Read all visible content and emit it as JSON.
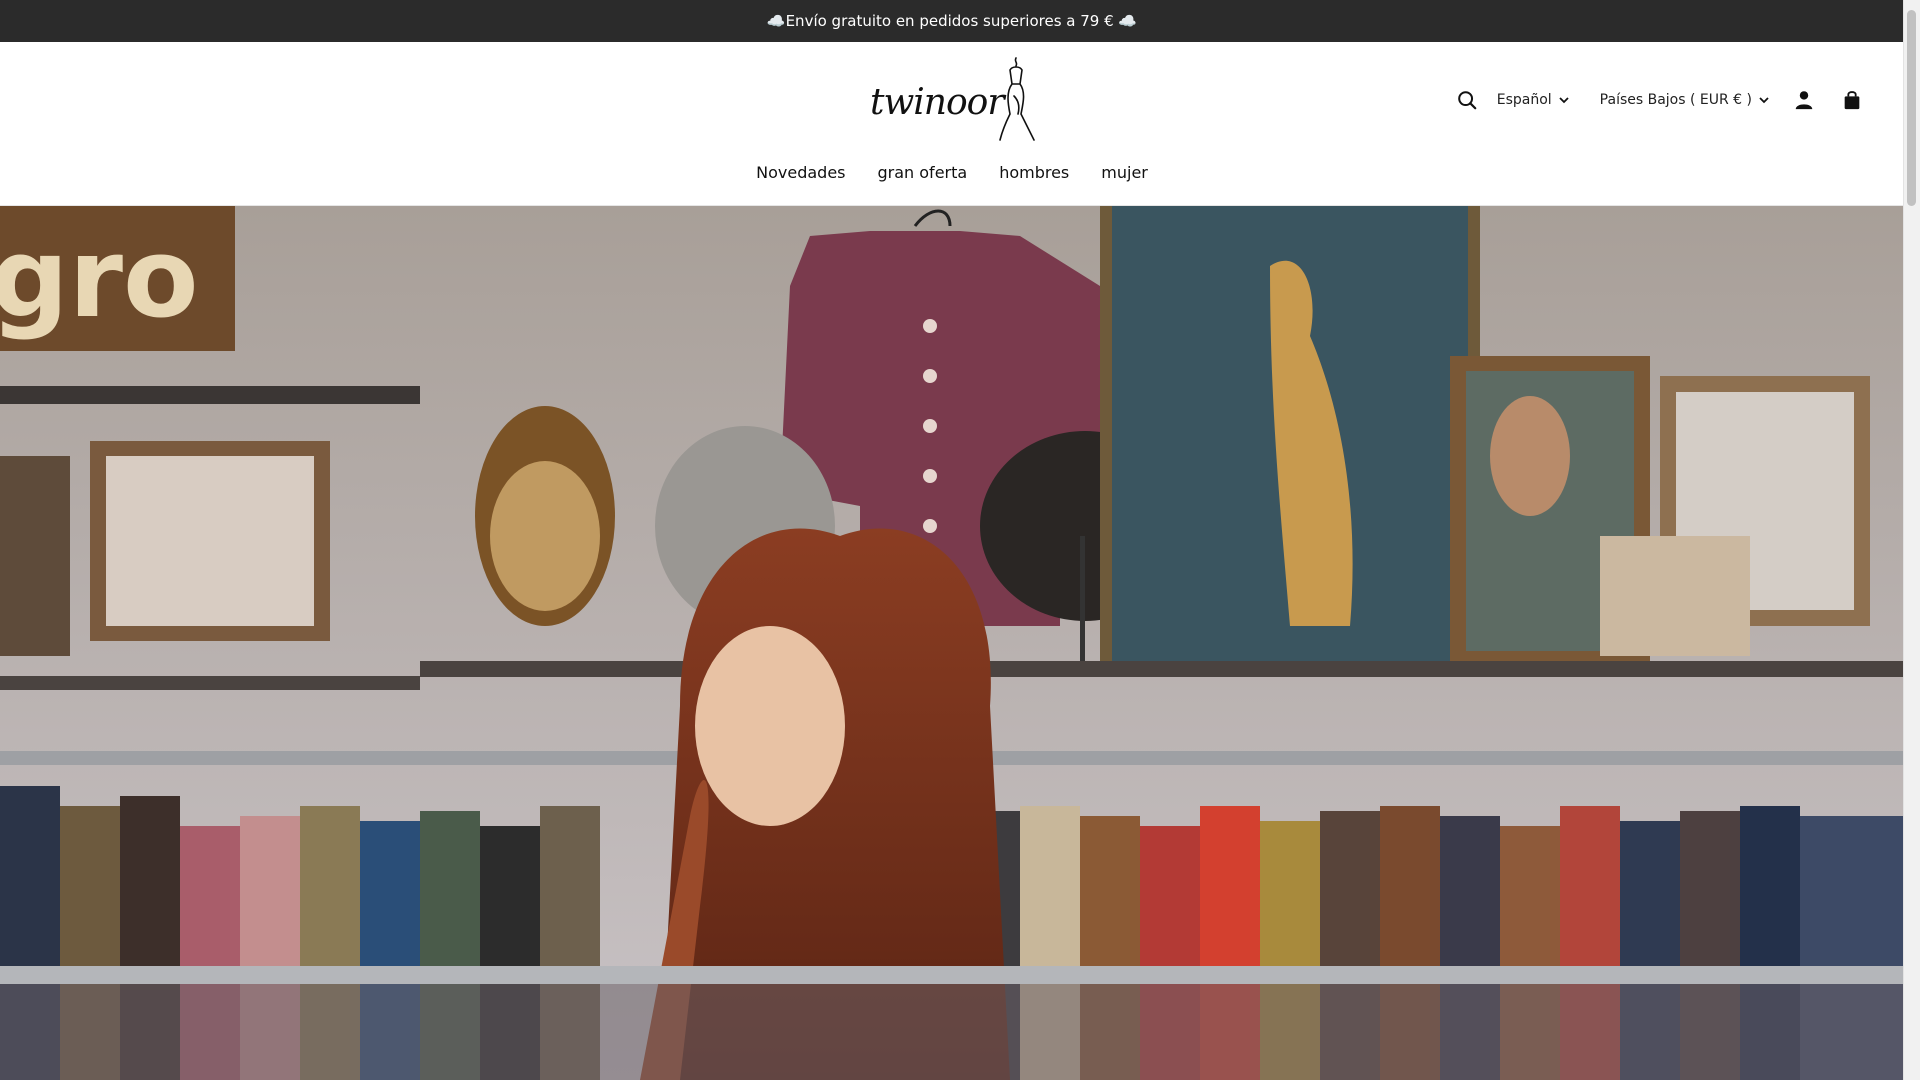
{
  "announcement": {
    "text": "☁️Envío gratuito en pedidos superiores a 79 € ☁️"
  },
  "header": {
    "logo_text": "twinoor",
    "language": "Español",
    "country": "Países Bajos ( EUR € )"
  },
  "nav": {
    "items": [
      {
        "label": "Novedades"
      },
      {
        "label": "gran oferta"
      },
      {
        "label": "hombres"
      },
      {
        "label": "mujer"
      }
    ]
  },
  "icons": {
    "search": "search-icon",
    "language_chevron": "chevron-down-icon",
    "country_chevron": "chevron-down-icon",
    "account": "account-icon",
    "cart": "shopping-bag-icon"
  },
  "colors": {
    "announcement_bg": "#2b2b2b",
    "text": "#111111",
    "background": "#ffffff"
  }
}
